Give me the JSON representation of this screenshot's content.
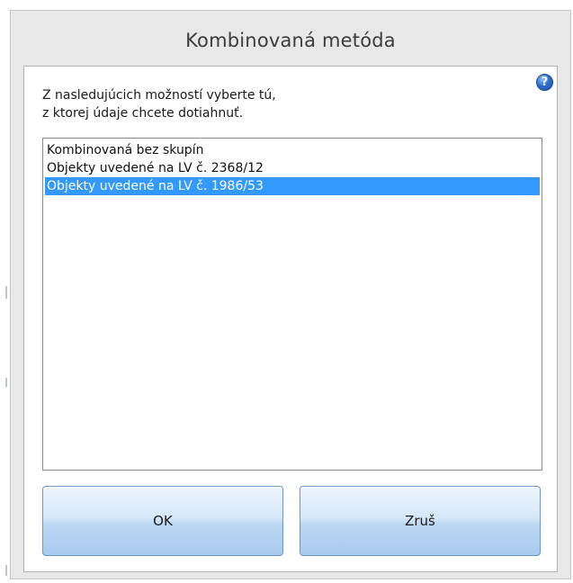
{
  "dialog": {
    "title": "Kombinovaná metóda",
    "help_icon": "question-mark-icon",
    "instruction_line1": "Z nasledujúcich možností vyberte tú,",
    "instruction_line2": "z ktorej údaje chcete dotiahnuť.",
    "list": {
      "items": [
        "Kombinovaná bez skupín",
        "Objekty uvedené na LV č. 2368/12",
        "Objekty uvedené na LV č. 1986/53"
      ],
      "selected_index": 2
    },
    "ok_label": "OK",
    "cancel_label": "Zruš"
  },
  "colors": {
    "selection": "#3399ff",
    "dialog_background": "#e8e8e8",
    "button_border": "#6b95c8"
  }
}
